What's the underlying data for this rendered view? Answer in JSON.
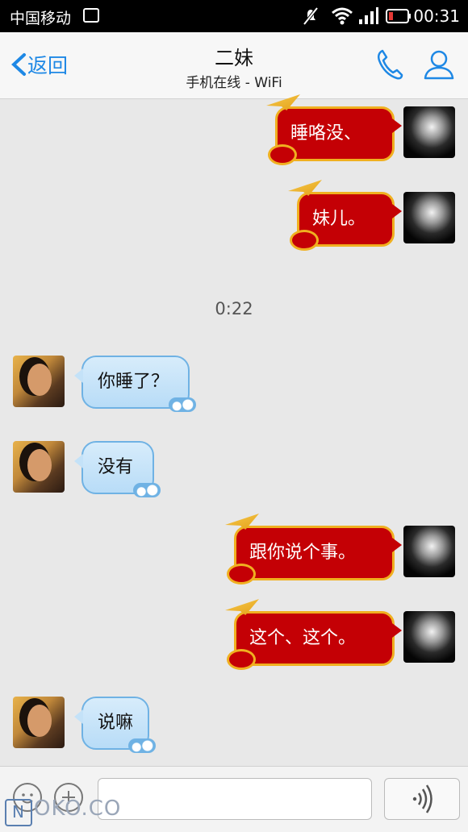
{
  "status_bar": {
    "carrier": "中国移动",
    "time": "00:31"
  },
  "header": {
    "back_label": "返回",
    "title": "二妹",
    "subtitle": "手机在线 - WiFi"
  },
  "messages": [
    {
      "from": "me",
      "text": "睡咯没、"
    },
    {
      "from": "me",
      "text": "妹儿。"
    },
    {
      "from": "her",
      "text": "你睡了？"
    },
    {
      "from": "her",
      "text": "没有"
    },
    {
      "from": "me",
      "text": "跟你说个事。"
    },
    {
      "from": "me",
      "text": "这个、这个。"
    },
    {
      "from": "her",
      "text": "说嘛"
    }
  ],
  "timestamp": "0:22",
  "input": {
    "value": "",
    "placeholder": ""
  },
  "watermark": "OKO.CO",
  "colors": {
    "accent": "#1e88e5",
    "my_bubble": "#c40005",
    "my_bubble_border": "#f0b020",
    "her_bubble": "#c4e2f8"
  },
  "icons": [
    "back-chevron-icon",
    "phone-icon",
    "profile-icon",
    "emoji-icon",
    "plus-icon",
    "voice-icon"
  ]
}
